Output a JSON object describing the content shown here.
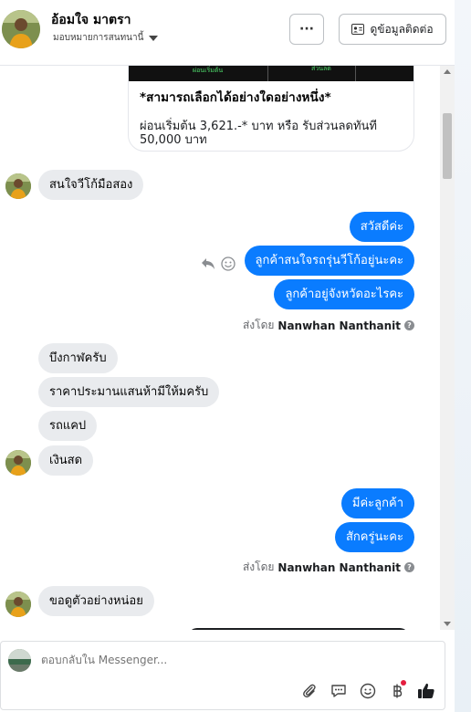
{
  "header": {
    "name": "อ้อมใจ มาตรา",
    "assign_label": "มอบหมายการสนทนานี้",
    "more_label": "···",
    "contact_info_label": "ดูข้อมูลติดต่อ"
  },
  "card": {
    "image_label_1": "ผ่อนเริ่มต้น",
    "image_label_2": "ส่วนลด",
    "line1": "*สามารถเลือกได้อย่างใดอย่างหนึ่ง*",
    "line2": "ผ่อนเริ่มต้น 3,621.-* บาท หรือ รับส่วนลดทันที 50,000 บาท"
  },
  "messages": {
    "in_1": "สนใจวีโก้มือสอง",
    "out_1": "สวัสดีค่ะ",
    "out_2": "ลูกค้าสนใจรถรุ่นวีโก้อยู่นะคะ",
    "out_3": "ลูกค้าอยู่จังหวัดอะไรคะ",
    "sent_by_1_prefix": "ส่งโดย",
    "sent_by_1_name": "Nanwhan Nanthanit",
    "in_2": "บึงกาฬครับ",
    "in_3": "ราคาประมานแสนห้ามีให้มครับ",
    "in_4": "รถแคป",
    "in_5": "เงินสด",
    "out_4": "มีค่ะลูกค้า",
    "out_5": "สักครู่นะคะ",
    "sent_by_2_prefix": "ส่งโดย",
    "sent_by_2_name": "Nanwhan Nanthanit",
    "in_6": "ขอดูตัวอย่างหน่อย"
  },
  "composer": {
    "placeholder": "ตอบกลับใน Messenger..."
  },
  "colors": {
    "outgoing_bubble": "#0a7cff",
    "incoming_bubble": "#e9ebee",
    "like_icon": "#1c1e21"
  }
}
